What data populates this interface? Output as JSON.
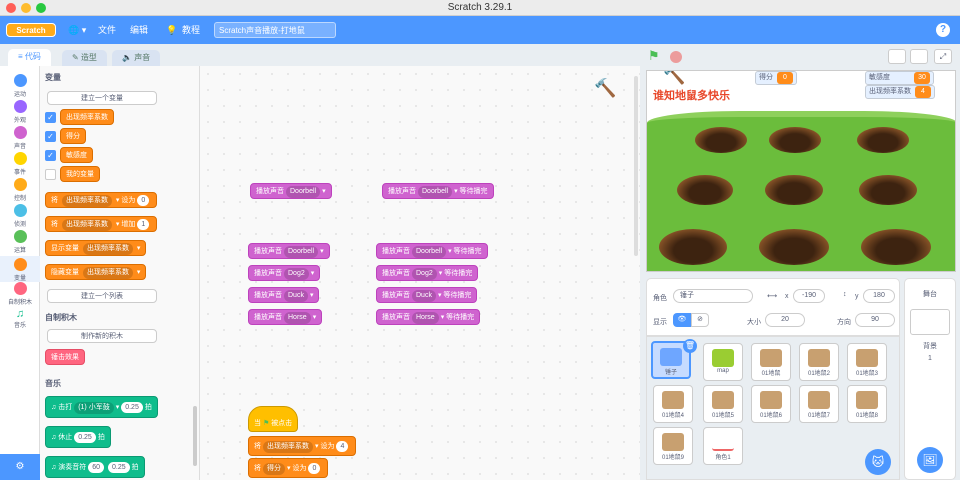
{
  "window": {
    "title": "Scratch 3.29.1"
  },
  "menu": {
    "logo": "Scratch",
    "file": "文件",
    "edit": "编辑",
    "tutorials": "教程",
    "project_title": "Scratch声音播放-打地鼠"
  },
  "tabs": {
    "code": "代码",
    "costumes": "造型",
    "sounds": "声音"
  },
  "categories": [
    "运动",
    "外观",
    "声音",
    "事件",
    "控制",
    "侦测",
    "运算",
    "变量",
    "自制积木",
    "音乐"
  ],
  "palette": {
    "var_header": "变量",
    "make_var": "建立一个变量",
    "vars": [
      "出现频率系数",
      "得分",
      "敏感度",
      "我的变量"
    ],
    "set_block": {
      "op": "将",
      "var": "出现频率系数",
      "to": "设为",
      "val": "0"
    },
    "change_block": {
      "op": "将",
      "var": "出现频率系数",
      "by": "增加",
      "val": "1"
    },
    "show_block": {
      "op": "显示变量",
      "var": "出现频率系数"
    },
    "hide_block": {
      "op": "隐藏变量",
      "var": "出现频率系数"
    },
    "make_list": "建立一个列表",
    "myblocks_header": "自制积木",
    "make_block": "制作新的积木",
    "custom_block": "锤击效果",
    "music_header": "音乐",
    "drum_block": {
      "a": "击打",
      "b": "(1) 小军鼓",
      "val": "0.25",
      "c": "拍"
    },
    "rest_block": {
      "a": "休止",
      "val": "0.25",
      "c": "拍"
    },
    "note_block": {
      "a": "演奏音符",
      "n": "60",
      "val": "0.25",
      "c": "拍"
    }
  },
  "script": {
    "play": "播放声音",
    "play_wait": "播放声音",
    "until_done": "等待播完",
    "sounds": [
      "Doorbell",
      "Dog2",
      "Duck",
      "Horse"
    ],
    "single_sound": "Doorbell",
    "hat": {
      "a": "当",
      "b": "被点击"
    },
    "set1": {
      "op": "将",
      "var": "出现频率系数",
      "to": "设为",
      "val": "4"
    },
    "set2": {
      "op": "将",
      "var": "得分",
      "to": "设为",
      "val": "0"
    }
  },
  "stage": {
    "title": "谁知地鼠多快乐",
    "monitors": [
      {
        "label": "得分",
        "value": "0"
      },
      {
        "label": "敏感度",
        "value": "30"
      },
      {
        "label": "出现频率系数",
        "value": "4"
      }
    ]
  },
  "sprite_info": {
    "sprite_label": "角色",
    "sprite_name": "锤子",
    "x_label": "x",
    "x": "-190",
    "y_label": "y",
    "y": "180",
    "show_label": "显示",
    "size_label": "大小",
    "size": "20",
    "dir_label": "方向",
    "dir": "90"
  },
  "sprites": [
    "锤子",
    "map",
    "01地鼠",
    "01地鼠2",
    "01地鼠3",
    "01地鼠4",
    "01地鼠5",
    "01地鼠6",
    "01地鼠7",
    "01地鼠8",
    "01地鼠9",
    "角色1"
  ],
  "stage_pane": {
    "label": "舞台",
    "backdrop_label": "背景",
    "backdrop_count": "1"
  },
  "colors": {
    "accent": "#4c97ff",
    "variables": "#ff8c1a",
    "sound": "#cf63cf",
    "music": "#0fbd8c"
  }
}
